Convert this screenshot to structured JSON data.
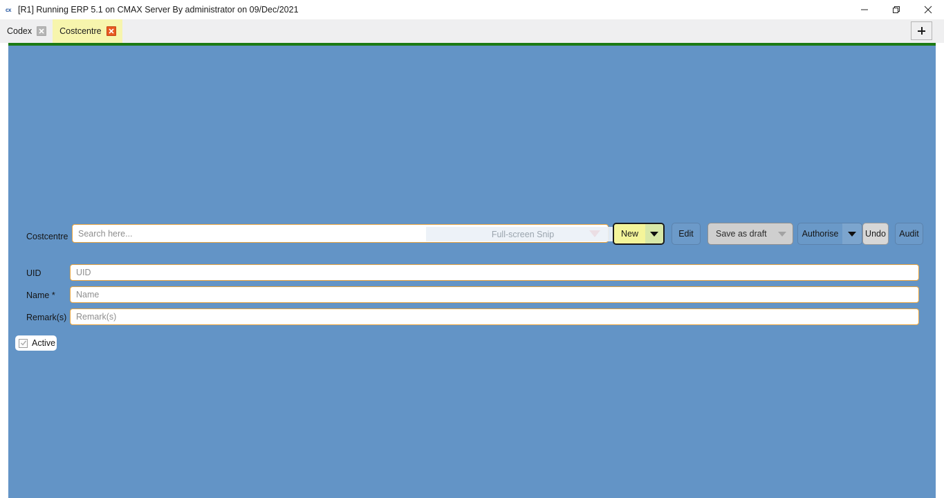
{
  "window": {
    "app_icon": "cx",
    "title": "[R1] Running ERP 5.1 on CMAX Server By administrator on 09/Dec/2021",
    "controls": {
      "minimize": "minimize-icon",
      "restore": "restore-icon",
      "close": "close-icon"
    }
  },
  "tabs": {
    "items": [
      {
        "label": "Codex",
        "active": false,
        "close_icon": "close-icon"
      },
      {
        "label": "Costcentre",
        "active": true,
        "close_icon": "close-icon"
      }
    ],
    "new_tab_label": "+"
  },
  "toolbar": {
    "search_label": "Costcentre",
    "search_placeholder": "Search here...",
    "search_value": "",
    "snip_overlay_text": "Full-screen Snip",
    "dropdown_icon": "chevron-down-icon",
    "buttons": {
      "new": "New",
      "edit": "Edit",
      "save_as_draft": "Save as draft",
      "authorise": "Authorise",
      "undo": "Undo",
      "audit": "Audit"
    }
  },
  "form": {
    "fields": [
      {
        "label": "UID",
        "placeholder": "UID",
        "value": ""
      },
      {
        "label": "Name *",
        "placeholder": "Name",
        "value": ""
      },
      {
        "label": "Remark(s)",
        "placeholder": "Remark(s)",
        "value": ""
      }
    ],
    "active_checkbox": {
      "label": "Active",
      "checked": true
    }
  },
  "colors": {
    "content_background": "#6394c6",
    "accent_green": "#1c7a14",
    "field_border": "#e8a33d",
    "active_tab": "#f7f5ad",
    "new_button": "#f4f59a",
    "dropdown_red": "#e00000"
  }
}
